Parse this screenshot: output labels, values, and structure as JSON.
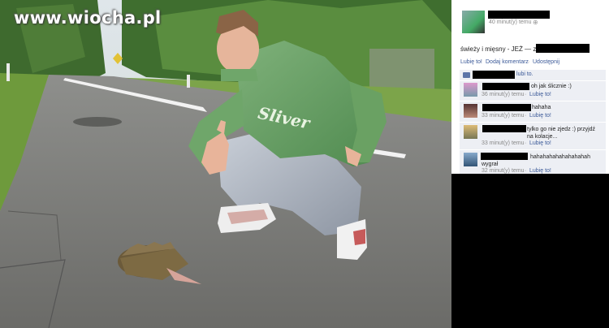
{
  "watermark": "www.wiocha.pl",
  "post": {
    "time": "40 minut(y) temu",
    "caption": "świeży i mięsny - JEŻ — z:",
    "actions": {
      "like": "Lubię to!",
      "comment": "Dodaj komentarz",
      "share": "Udostępnij"
    },
    "likes_text": "lubi to."
  },
  "comments": [
    {
      "text": "oh jak ślicznie :)",
      "time": "36 minut(y) temu",
      "like": "Lubię to!"
    },
    {
      "text": "hahaha",
      "time": "33 minut(y) temu",
      "like": "Lubię to!"
    },
    {
      "text": "tylko go nie zjedz :) przyjdź na kolacje...",
      "time": "33 minut(y) temu",
      "like": "Lubię to!"
    },
    {
      "text": "hahahahahahahahahah wygrał",
      "time": "32 minut(y) temu",
      "like": "Lubię to!"
    }
  ],
  "separator": "·",
  "colors": {
    "link": "#3b5998",
    "panel_bg": "#ffffff",
    "comment_bg": "#edeff4",
    "redaction": "#000000"
  }
}
